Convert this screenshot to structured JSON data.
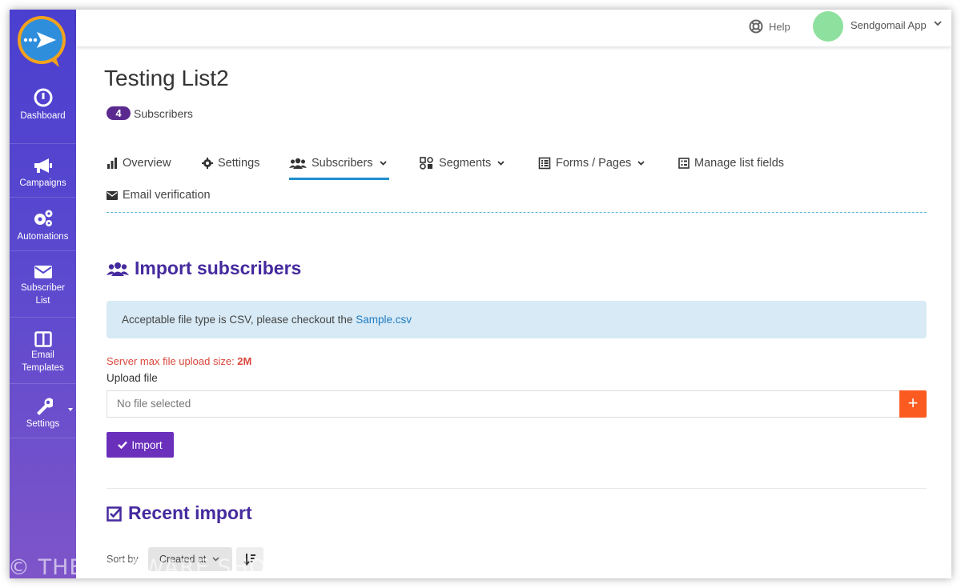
{
  "colors": {
    "sidebar_top": "#4a3fcf",
    "sidebar_bottom": "#7e55c9",
    "accent": "#452a9e",
    "badge": "#5a2a8f",
    "import_button": "#6a30bb",
    "add_button": "#fb5a21",
    "tab_active": "#1f8ecd",
    "info_bg": "#d7eaf5",
    "error": "#d9473b"
  },
  "sidebar": {
    "logo_icon": "paper-plane-chat-logo",
    "items": [
      {
        "label": "Dashboard",
        "icon": "gauge-icon"
      },
      {
        "label": "Campaigns",
        "icon": "megaphone-icon"
      },
      {
        "label": "Automations",
        "icon": "gears-icon"
      },
      {
        "label": "Subscriber List",
        "label_line1": "Subscriber",
        "label_line2": "List",
        "icon": "envelope-icon"
      },
      {
        "label": "Email Templates",
        "label_line1": "Email",
        "label_line2": "Templates",
        "icon": "columns-icon"
      },
      {
        "label": "Settings",
        "icon": "wrench-icon"
      }
    ]
  },
  "topbar": {
    "help": "Help",
    "user_name": "Sendgomail App"
  },
  "page": {
    "title": "Testing List2",
    "subscriber_count": "4",
    "subscriber_label": "Subscribers"
  },
  "tabs": [
    {
      "label": "Overview",
      "icon": "bar-chart-icon"
    },
    {
      "label": "Settings",
      "icon": "gear-icon"
    },
    {
      "label": "Subscribers",
      "icon": "users-icon",
      "active": true
    },
    {
      "label": "Segments",
      "icon": "segments-icon"
    },
    {
      "label": "Forms / Pages",
      "icon": "form-icon"
    },
    {
      "label": "Manage list fields",
      "icon": "list-fields-icon"
    },
    {
      "label": "Email verification",
      "icon": "envelope-icon"
    }
  ],
  "import": {
    "title": "Import subscribers",
    "info_text": "Acceptable file type is CSV, please checkout the ",
    "info_link": "Sample.csv",
    "max_size_label": "Server max file upload size: ",
    "max_size_value": "2M",
    "upload_label": "Upload file",
    "file_placeholder": "No file selected",
    "add_label": "+",
    "button_label": "Import"
  },
  "recent": {
    "title": "Recent import",
    "sort_label": "Sort by",
    "sort_value": "Created at"
  },
  "watermark": "© THESOFTWARE.SHOP"
}
